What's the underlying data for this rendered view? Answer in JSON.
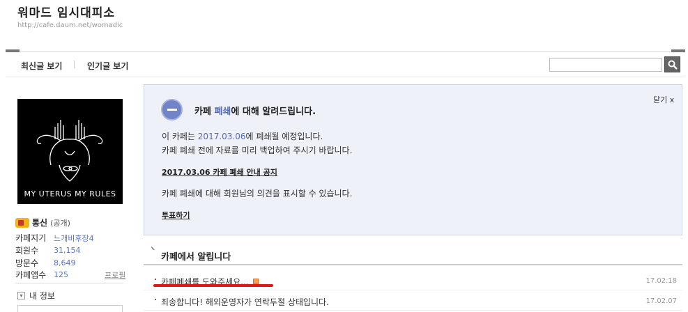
{
  "header": {
    "cafe_name": "워마드 임시대피소",
    "cafe_url": "http://cafe.daum.net/womadic"
  },
  "nav": {
    "tabs": [
      {
        "label": "최신글 보기"
      },
      {
        "label": "인기글 보기"
      }
    ],
    "search": {
      "placeholder": "",
      "button_icon": "search-icon"
    }
  },
  "sidebar": {
    "profile_caption": "MY UTERUS MY RULES",
    "grade": {
      "name": "통신",
      "type": "(공개)"
    },
    "info": [
      {
        "label": "카페지기",
        "value": "느개비후장4"
      },
      {
        "label": "회원수",
        "value": "31,154"
      },
      {
        "label": "방문수",
        "value": "8,649"
      },
      {
        "label": "카페앱수",
        "value": "125"
      }
    ],
    "profile_link": "프로필",
    "my_info": {
      "toggle": "▾",
      "label": "내 정보"
    }
  },
  "notice": {
    "close_label": "닫기 x",
    "heading_pre": "카페 ",
    "heading_hl": "폐쇄",
    "heading_post": "에 대해 알려드립니다.",
    "line1_pre": "이 카페는 ",
    "line1_date": "2017.03.06",
    "line1_post": "에 폐쇄될 예정입니다.",
    "line2": "카페 폐쇄 전에 자료를 미리 백업하여 주시기 바랍니다.",
    "link1": "2017.03.06 카페 폐쇄 안내 공지",
    "line3": "카페 폐쇄에 대해 회원님의 의견을 표시할 수 있습니다.",
    "link2": "투표하기"
  },
  "board": {
    "title": "카페에서 알립니다",
    "posts": [
      {
        "title": "카페폐쇄를 도와주세요...",
        "date": "17.02.18",
        "is_new": true
      },
      {
        "title": "죄송합니다! 해외운영자가 연락두절 상태입니다.",
        "date": "17.02.07",
        "is_new": false
      }
    ]
  },
  "colors": {
    "accent": "#5568c0",
    "notice_bg": "#eef2f8",
    "highlight_mark": "#e01818"
  }
}
